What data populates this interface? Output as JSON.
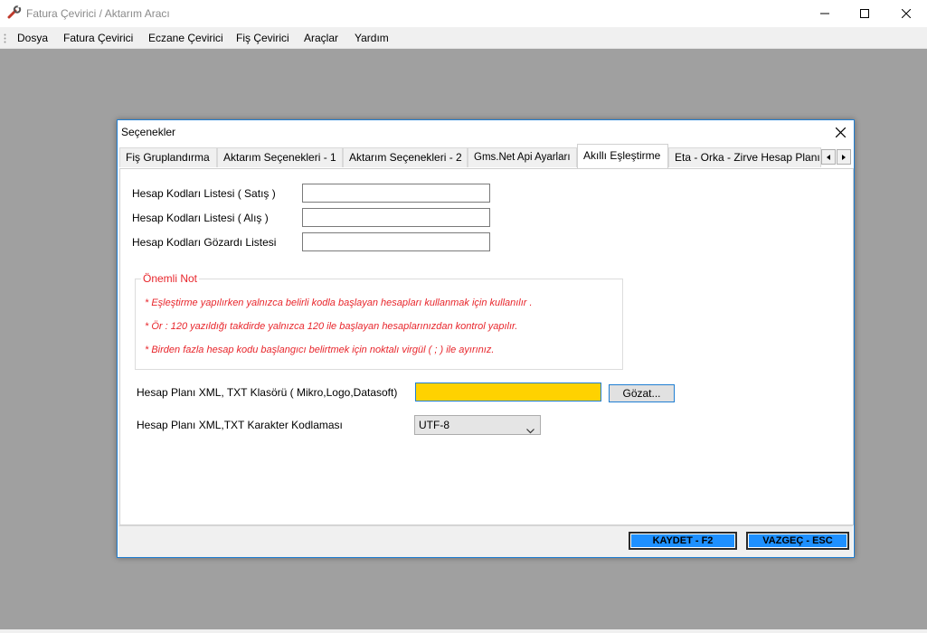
{
  "window": {
    "title": "Fatura Çevirici / Aktarım Aracı",
    "icon": "wrench-icon"
  },
  "menu": {
    "items": [
      {
        "label": "Dosya"
      },
      {
        "label": "Fatura Çevirici"
      },
      {
        "label": "Eczane Çevirici"
      },
      {
        "label": "Fiş Çevirici"
      },
      {
        "label": "Araçlar"
      },
      {
        "label": "Yardım"
      }
    ]
  },
  "dialog": {
    "title": "Seçenekler",
    "tabs": [
      {
        "label": "Fiş Gruplandırma"
      },
      {
        "label": "Aktarım Seçenekleri - 1"
      },
      {
        "label": "Aktarım Seçenekleri - 2"
      },
      {
        "label": "Gms.Net Api Ayarları"
      },
      {
        "label": "Akıllı Eşleştirme",
        "active": true
      },
      {
        "label": "Eta - Orka - Zirve Hesap Planı"
      }
    ],
    "fields": {
      "satis_label": "Hesap Kodları Listesi ( Satış )",
      "satis_value": "",
      "alis_label": "Hesap Kodları Listesi ( Alış )",
      "alis_value": "",
      "gozardi_label": "Hesap Kodları Gözardı Listesi",
      "gozardi_value": ""
    },
    "note": {
      "title": "Önemli Not",
      "lines": [
        "* Eşleştirme yapılırken yalnızca belirli kodla başlayan hesapları kullanmak için kullanılır .",
        "* Ör : 120 yazıldığı takdirde yalnızca 120 ile başlayan hesaplarınızdan kontrol yapılır.",
        "* Birden fazla hesap kodu başlangıcı belirtmek için noktalı virgül ( ; ) ile ayırınız."
      ]
    },
    "folder": {
      "label": "Hesap Planı XML, TXT Klasörü ( Mikro,Logo,Datasoft)",
      "value": "",
      "browse_label": "Gözat..."
    },
    "encoding": {
      "label": "Hesap Planı XML,TXT Karakter Kodlaması",
      "selected": "UTF-8"
    },
    "buttons": {
      "save": "KAYDET - F2",
      "cancel": "VAZGEÇ - ESC"
    }
  },
  "colors": {
    "accent": "#1f7ed2",
    "note_red": "#e8262c",
    "folder_bg": "#ffd200",
    "action_btn": "#1e90ff",
    "desktop": "#a0a0a0"
  }
}
